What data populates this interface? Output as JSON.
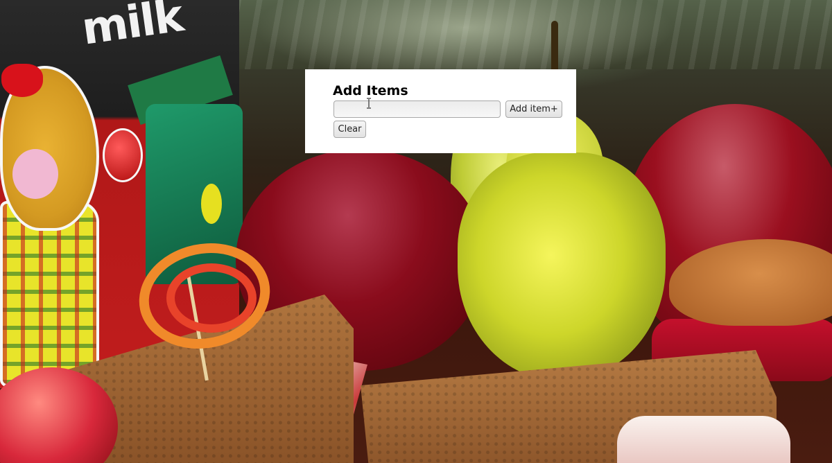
{
  "background": {
    "milk_text": "milk",
    "icon": "photo-background"
  },
  "panel": {
    "title": "Add Items",
    "input": {
      "value": "",
      "placeholder": ""
    },
    "add_button_label": "Add item+",
    "clear_button_label": "Clear"
  },
  "cursor": {
    "icon": "text-cursor-icon"
  },
  "colors": {
    "panel_bg": "#ffffff",
    "button_border": "#a8a8a8"
  }
}
